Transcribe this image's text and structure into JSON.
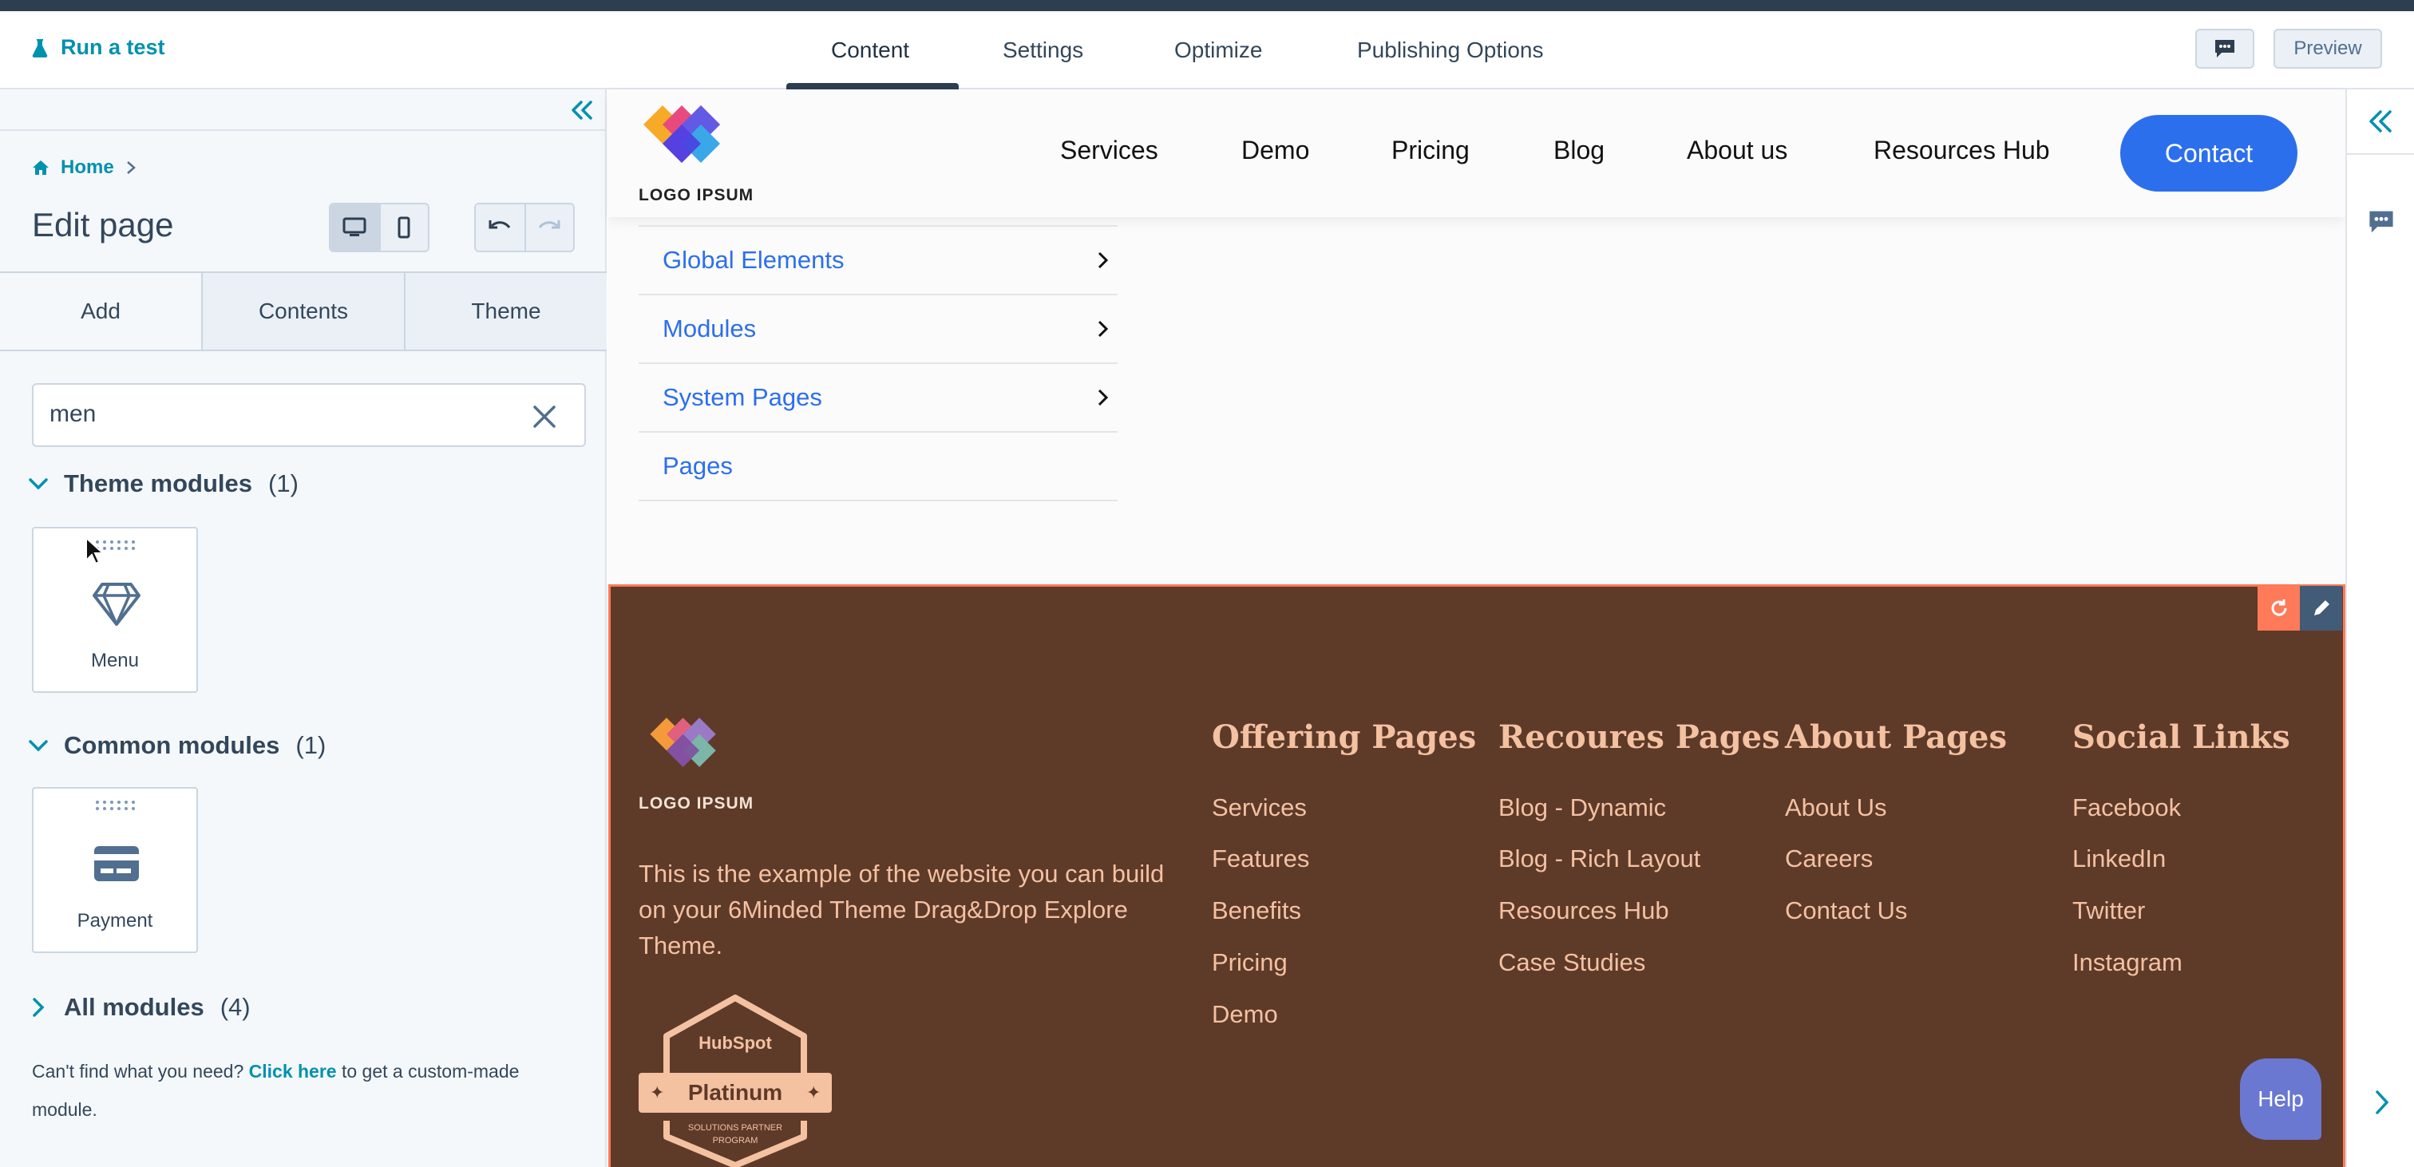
{
  "topbar": {
    "run_test": "Run a test",
    "tabs": [
      {
        "label": "Content",
        "active": true
      },
      {
        "label": "Settings",
        "active": false
      },
      {
        "label": "Optimize",
        "active": false
      },
      {
        "label": "Publishing Options",
        "active": false
      }
    ],
    "preview_label": "Preview"
  },
  "sidebar": {
    "breadcrumb_home": "Home",
    "title": "Edit page",
    "tabs": [
      "Add",
      "Contents",
      "Theme"
    ],
    "search_value": "men",
    "sections": [
      {
        "label": "Theme modules",
        "count": "(1)",
        "expanded": true,
        "modules": [
          {
            "label": "Menu",
            "icon": "diamond-icon"
          }
        ]
      },
      {
        "label": "Common modules",
        "count": "(1)",
        "expanded": true,
        "modules": [
          {
            "label": "Payment",
            "icon": "payment-card-icon"
          }
        ]
      },
      {
        "label": "All modules",
        "count": "(4)",
        "expanded": false,
        "modules": []
      }
    ],
    "help_prefix": "Can't find what you need?",
    "help_link": "Click here",
    "help_suffix": "to get a custom-made module."
  },
  "site": {
    "logo_text": "LOGO IPSUM",
    "nav": [
      "Services",
      "Demo",
      "Pricing",
      "Blog",
      "About us",
      "Resources Hub"
    ],
    "contact_label": "Contact",
    "sitemap": [
      {
        "label": "Global Elements",
        "has_children": true
      },
      {
        "label": "Modules",
        "has_children": true
      },
      {
        "label": "System Pages",
        "has_children": true
      },
      {
        "label": "Pages",
        "has_children": false
      }
    ],
    "footer": {
      "logo_text": "LOGO IPSUM",
      "description": "This is the example of the website you can build on your 6Minded Theme Drag&Drop Explore Theme.",
      "badge_brand": "HubSpot",
      "badge_tier": "Platinum",
      "badge_sub1": "SOLUTIONS PARTNER",
      "badge_sub2": "PROGRAM",
      "columns": [
        {
          "heading": "Offering Pages",
          "links": [
            "Services",
            "Features",
            "Benefits",
            "Pricing",
            "Demo"
          ]
        },
        {
          "heading": "Recoures Pages",
          "links": [
            "Blog - Dynamic",
            "Blog - Rich Layout",
            "Resources Hub",
            "Case Studies"
          ]
        },
        {
          "heading": "About Pages",
          "links": [
            "About Us",
            "Careers",
            "Contact Us"
          ]
        },
        {
          "heading": "Social Links",
          "links": [
            "Facebook",
            "LinkedIn",
            "Twitter",
            "Instagram"
          ]
        }
      ]
    },
    "help_label": "Help"
  },
  "colors": {
    "accent": "#0091ae",
    "brand_blue": "#2c6fec",
    "footer_bg": "#5e3a29",
    "footer_text": "#f4c1a1",
    "selection": "#ff7a59"
  }
}
